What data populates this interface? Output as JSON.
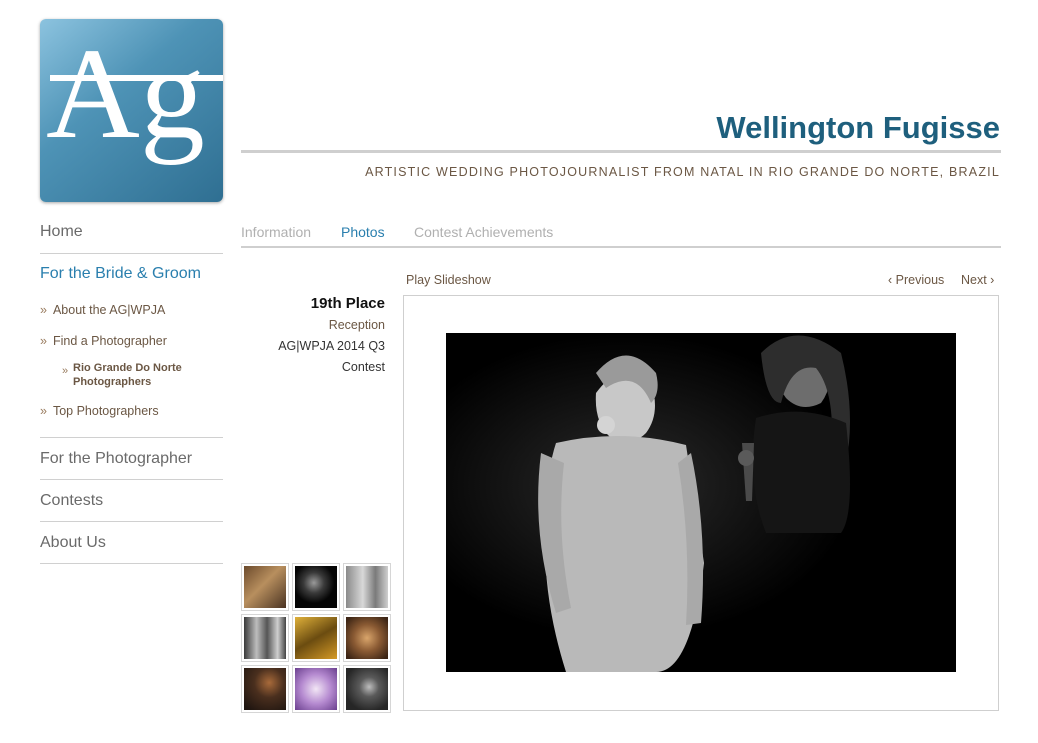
{
  "logo": {
    "text": "Ag"
  },
  "header": {
    "title": "Wellington Fugisse",
    "tagline": "ARTISTIC WEDDING PHOTOJOURNALIST FROM NATAL IN RIO GRANDE DO NORTE, BRAZIL"
  },
  "nav": {
    "home": "Home",
    "bride_groom": "For the Bride & Groom",
    "sub_items": [
      "About the AG|WPJA",
      "Find a Photographer",
      "Rio Grande Do Norte Photographers",
      "Top Photographers"
    ],
    "arrow": "»",
    "for_photographer": "For the Photographer",
    "contests": "Contests",
    "about": "About Us"
  },
  "tabs": [
    "Information",
    "Photos",
    "Contest Achievements"
  ],
  "award": {
    "place": "19th Place",
    "category": "Reception",
    "contest": "AG|WPJA 2014 Q3",
    "contest_suffix": "Contest"
  },
  "controls": {
    "play_slideshow": "Play Slideshow",
    "previous": "‹ Previous",
    "next": "Next ›"
  },
  "colors": {
    "accent_blue": "#2a7fae",
    "title_blue": "#1e5f7d",
    "brown_text": "#6b5744"
  }
}
